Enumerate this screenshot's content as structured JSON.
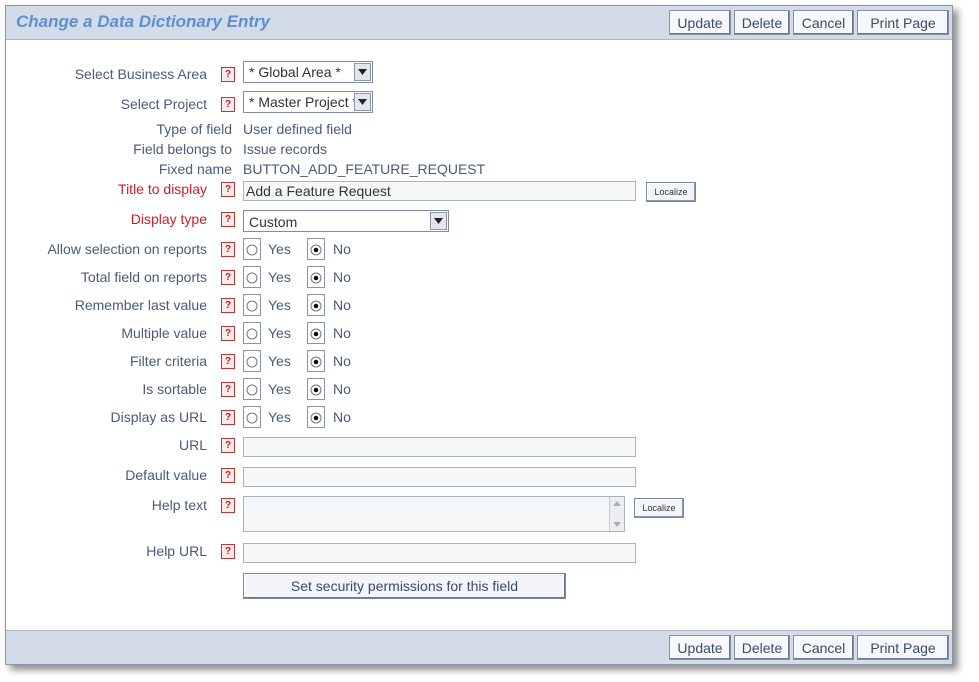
{
  "header": {
    "title": "Change a Data Dictionary Entry",
    "buttons": [
      "Update",
      "Delete",
      "Cancel",
      "Print Page"
    ]
  },
  "footer": {
    "buttons": [
      "Update",
      "Delete",
      "Cancel",
      "Print Page"
    ]
  },
  "help_marker": "?",
  "form": {
    "business_area": {
      "label": "Select Business Area",
      "value": "* Global Area *"
    },
    "project": {
      "label": "Select Project",
      "value": "* Master Project *"
    },
    "type_of_field": {
      "label": "Type of field",
      "value": "User defined field"
    },
    "field_belongs_to": {
      "label": "Field belongs to",
      "value": "Issue records"
    },
    "fixed_name": {
      "label": "Fixed name",
      "value": "BUTTON_ADD_FEATURE_REQUEST"
    },
    "title_to_display": {
      "label": "Title to display",
      "value": "Add a Feature Request",
      "localize": "Localize"
    },
    "display_type": {
      "label": "Display type",
      "value": "Custom"
    },
    "yes_label": "Yes",
    "no_label": "No",
    "radio_rows": [
      {
        "label": "Allow selection on reports",
        "selected": "No"
      },
      {
        "label": "Total field on reports",
        "selected": "No"
      },
      {
        "label": "Remember last value",
        "selected": "No"
      },
      {
        "label": "Multiple value",
        "selected": "No"
      },
      {
        "label": "Filter criteria",
        "selected": "No"
      },
      {
        "label": "Is sortable",
        "selected": "No"
      },
      {
        "label": "Display as URL",
        "selected": "No"
      }
    ],
    "url": {
      "label": "URL",
      "value": ""
    },
    "default_value": {
      "label": "Default value",
      "value": ""
    },
    "help_text": {
      "label": "Help text",
      "value": "",
      "localize": "Localize"
    },
    "help_url": {
      "label": "Help URL",
      "value": ""
    },
    "security_button": "Set security permissions for this field"
  },
  "colors": {
    "bar_bg": "#d3dbe8",
    "title": "#5f8ed0",
    "required_label": "#c8202a",
    "label": "#4a5a7a"
  }
}
